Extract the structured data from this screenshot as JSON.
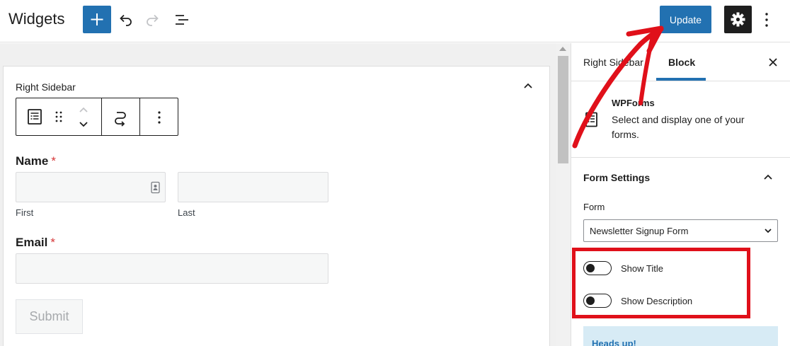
{
  "header": {
    "title": "Widgets",
    "update_label": "Update"
  },
  "widget_area": {
    "title": "Right Sidebar"
  },
  "form": {
    "name_label": "Name",
    "required_mark": "*",
    "first_label": "First",
    "last_label": "Last",
    "email_label": "Email",
    "submit_label": "Submit"
  },
  "sidebar": {
    "tabs": [
      {
        "label": "Right Sidebar"
      },
      {
        "label": "Block"
      }
    ],
    "block": {
      "name": "WPForms",
      "description": "Select and display one of your forms."
    },
    "panel": {
      "title": "Form Settings",
      "form_label": "Form",
      "form_value": "Newsletter Signup Form",
      "toggles": [
        {
          "label": "Show Title"
        },
        {
          "label": "Show Description"
        }
      ]
    },
    "notice": {
      "title": "Heads up!"
    }
  },
  "colors": {
    "primary": "#2271b1",
    "annotation": "#e0101a",
    "required": "#d63638"
  }
}
